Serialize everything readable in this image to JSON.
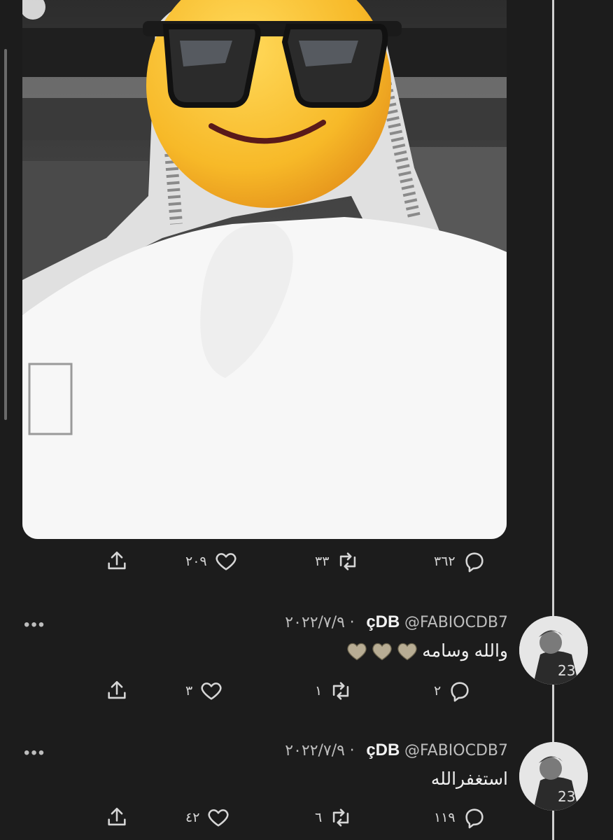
{
  "post": {
    "stats": {
      "replies": "٣٦٢",
      "retweets": "٣٣",
      "likes": "٢٠٩"
    }
  },
  "replies": [
    {
      "name": "çDB",
      "handle": "@FABIOCDB7",
      "separator": "·",
      "date": "٢٠٢٢/٧/٩",
      "text": "والله وسامه",
      "emoji": [
        "white-heart",
        "white-heart",
        "white-heart"
      ],
      "stats": {
        "replies": "٢",
        "retweets": "١",
        "likes": "٣"
      }
    },
    {
      "name": "çDB",
      "handle": "@FABIOCDB7",
      "separator": "·",
      "date": "٢٠٢٢/٧/٩",
      "text": "استغفرالله",
      "stats": {
        "replies": "١١٩",
        "retweets": "٦",
        "likes": "٤٢"
      }
    }
  ],
  "icons": {
    "reply": "comment-bubble-icon",
    "retweet": "retweet-icon",
    "like": "heart-outline-icon",
    "share": "share-upload-icon",
    "more": "more-dots-icon"
  },
  "colors": {
    "background": "#1c1c1c",
    "text": "#e8e8e8",
    "muted": "#bdbdbd",
    "thread_line": "#cfcfcf",
    "emoji_face": "#f7b928"
  }
}
